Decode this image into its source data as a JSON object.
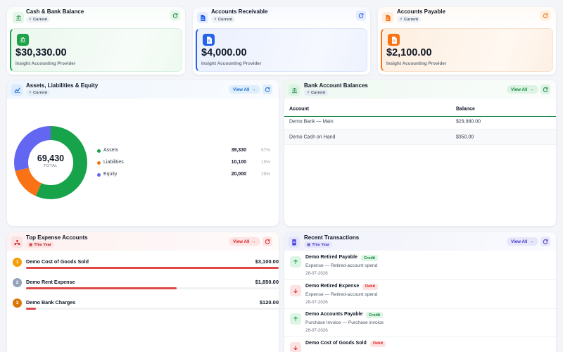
{
  "kpis": [
    {
      "title": "Cash & Bank Balance",
      "badge": "Current",
      "value": "$30,330.00",
      "provider": "Insight Accounting Provider",
      "accent": "#1fa34a"
    },
    {
      "title": "Accounts Receivable",
      "badge": "Current",
      "value": "$4,000.00",
      "provider": "Insight Accounting Provider",
      "accent": "#2563eb"
    },
    {
      "title": "Accounts Payable",
      "badge": "Current",
      "value": "$2,100.00",
      "provider": "Insight Accounting Provider",
      "accent": "#f97316"
    }
  ],
  "ale": {
    "title": "Assets, Liabilities & Equity",
    "badge": "Current",
    "view_all": "View All",
    "total_value": "69,430",
    "total_label": "TOTAL",
    "chart_data": {
      "type": "pie",
      "total": 69430,
      "categories": [
        "Assets",
        "Liabilities",
        "Equity"
      ],
      "values": [
        39330,
        10100,
        20000
      ],
      "values_display": [
        "39,330",
        "10,100",
        "20,000"
      ],
      "percents": [
        "57%",
        "15%",
        "29%"
      ],
      "colors": [
        "#16a34a",
        "#f97316",
        "#6366f1"
      ]
    }
  },
  "bank": {
    "title": "Bank Account Balances",
    "badge": "Current",
    "view_all": "View All",
    "columns": [
      "Account",
      "Balance"
    ],
    "rows": [
      {
        "account": "Demo Bank — Main",
        "balance": "$29,980.00"
      },
      {
        "account": "Demo Cash on Hand",
        "balance": "$350.00"
      }
    ]
  },
  "expenses": {
    "title": "Top Expense Accounts",
    "badge": "This Year",
    "view_all": "View All",
    "items": [
      {
        "rank": "1",
        "name": "Demo Cost of Goods Sold",
        "amount": "$3,100.00",
        "value": 3100,
        "rank_color": "#f59e0b"
      },
      {
        "rank": "2",
        "name": "Demo Rent Expense",
        "amount": "$1,850.00",
        "value": 1850,
        "rank_color": "#94a3b8"
      },
      {
        "rank": "3",
        "name": "Demo Bank Charges",
        "amount": "$120.00",
        "value": 120,
        "rank_color": "#d97706"
      }
    ]
  },
  "transactions": {
    "title": "Recent Transactions",
    "badge": "This Year",
    "view_all": "View All",
    "items": [
      {
        "title": "Demo Retired Payable",
        "type": "Credit",
        "direction": "up",
        "desc": "Expense — Retired-account spend",
        "date": "28-07-2026"
      },
      {
        "title": "Demo Retired Expense",
        "type": "Debit",
        "direction": "down",
        "desc": "Expense — Retired-account spend",
        "date": "28-07-2026"
      },
      {
        "title": "Demo Accounts Payable",
        "type": "Credit",
        "direction": "up",
        "desc": "Purchase Invoice — Purchase invoice",
        "date": "26-07-2026"
      },
      {
        "title": "Demo Cost of Goods Sold",
        "type": "Debit",
        "direction": "down",
        "desc": "",
        "date": ""
      }
    ]
  }
}
